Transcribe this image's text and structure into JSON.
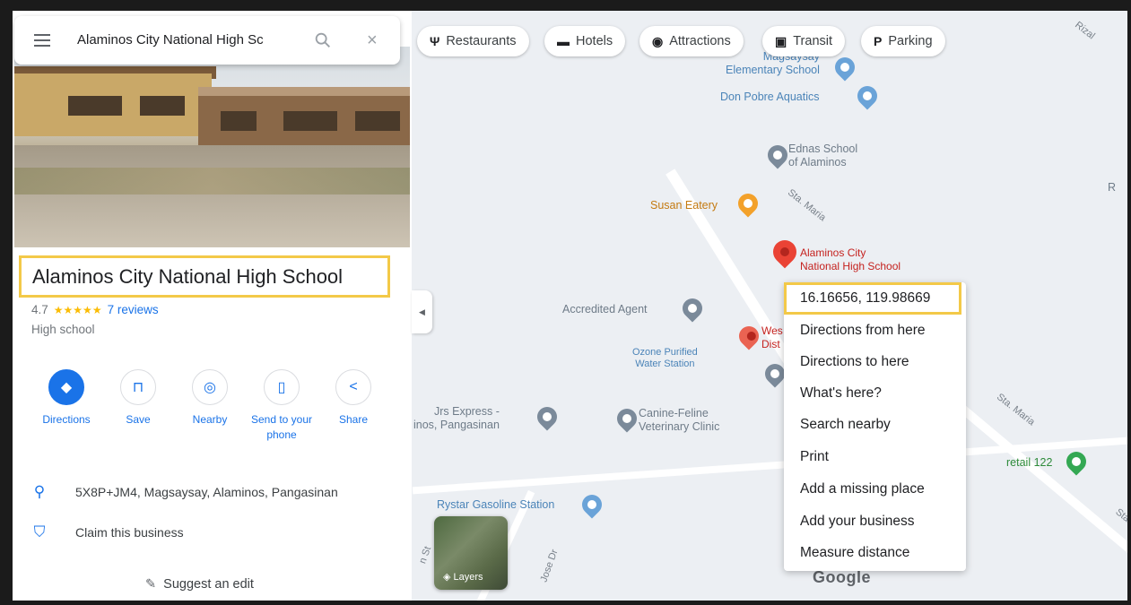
{
  "search": {
    "value": "Alaminos City National High Sc",
    "icons": {
      "menu": "hamburger-menu-icon",
      "search": "search-icon",
      "close": "close-icon"
    }
  },
  "chips": [
    {
      "label": "Restaurants",
      "icon": "Ψ"
    },
    {
      "label": "Hotels",
      "icon": "▬"
    },
    {
      "label": "Attractions",
      "icon": "◉"
    },
    {
      "label": "Transit",
      "icon": "▣"
    },
    {
      "label": "Parking",
      "icon": "P"
    }
  ],
  "place": {
    "title": "Alaminos City National High School",
    "rating": "4.7",
    "stars": "★★★★★",
    "reviews": "7 reviews",
    "category": "High school"
  },
  "actions": [
    {
      "label": "Directions",
      "icon": "◆"
    },
    {
      "label": "Save",
      "icon": "⊓"
    },
    {
      "label": "Nearby",
      "icon": "◎"
    },
    {
      "label": "Send to your phone",
      "icon": "▯"
    },
    {
      "label": "Share",
      "icon": "<"
    }
  ],
  "info": {
    "address": "5X8P+JM4, Magsaysay, Alaminos, Pangasinan",
    "claim": "Claim this business",
    "suggest": "Suggest an edit"
  },
  "map": {
    "labels": {
      "magsaysay": "Magsaysay\nElementary School",
      "don_pobre": "Don Pobre Aquatics",
      "ednas": "Ednas School\nof Alaminos",
      "susan": "Susan Eatery",
      "sta_maria_1": "Sta. Maria",
      "selected": "Alaminos City\nNational High School",
      "accredited": "Accredited Agent",
      "ozone": "Ozone Purified\nWater Station",
      "hospital": "Wes\nDist",
      "jrs": "Jrs Express -\ninos, Pangasinan",
      "canine": "Canine-Feline\nVeterinary Clinic",
      "sta_maria_2": "Sta. Maria",
      "retail": "retail 122",
      "rystar": "Rystar Gasoline Station",
      "rizal": "Rizal",
      "r_edge": "R",
      "st_edge": "Sta",
      "jose": "Jose Dr",
      "street_left": "n St"
    },
    "layers": "Layers",
    "google": "Google"
  },
  "context_menu": {
    "coordinates": "16.16656, 119.98669",
    "items": [
      "Directions from here",
      "Directions to here",
      "What's here?",
      "Search nearby",
      "Print",
      "Add a missing place",
      "Add your business",
      "Measure distance"
    ]
  },
  "colors": {
    "accent": "#1a73e8",
    "highlight": "#f3c948",
    "pin_red": "#ea4335",
    "star": "#fbbc04"
  }
}
